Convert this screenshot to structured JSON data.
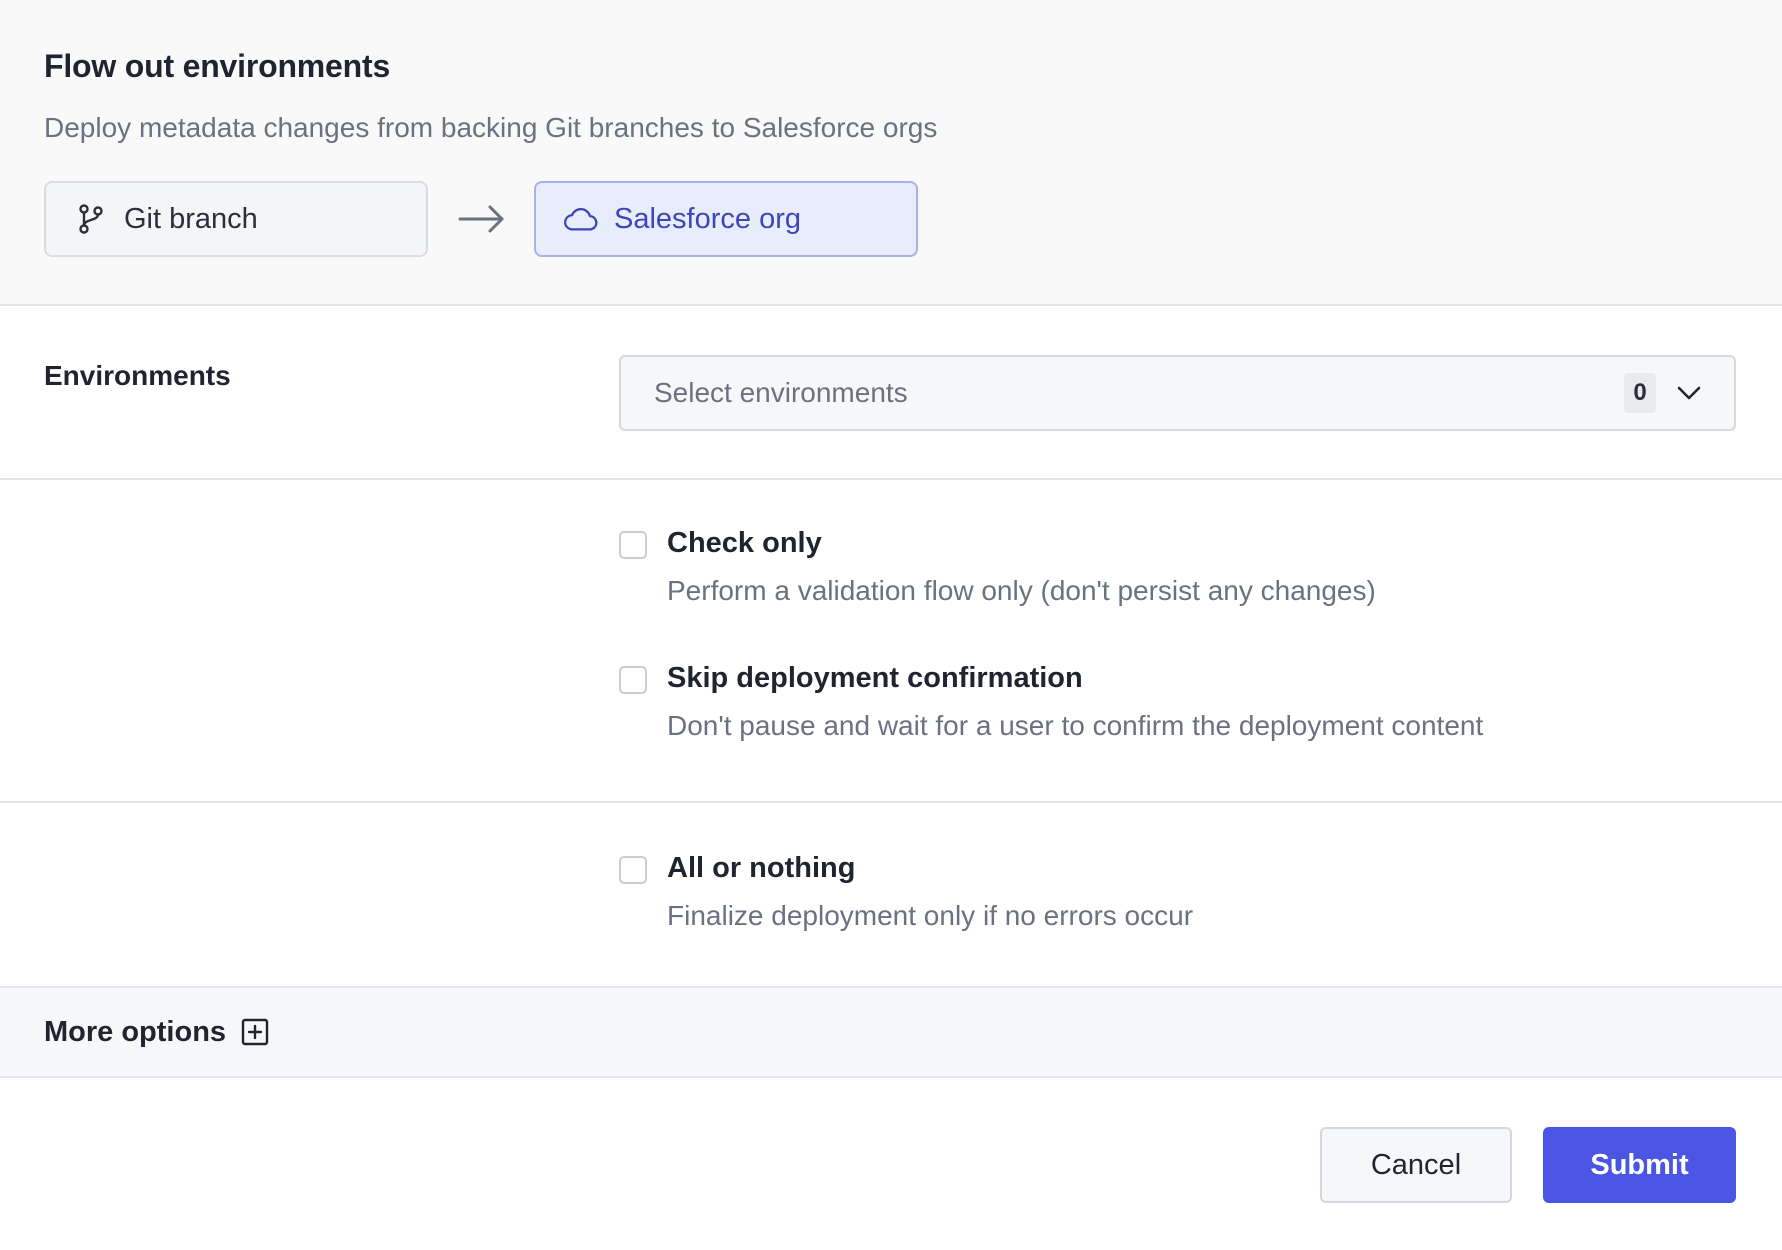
{
  "header": {
    "title": "Flow out environments",
    "subtitle": "Deploy metadata changes from backing Git branches to Salesforce orgs",
    "source": {
      "label": "Git branch",
      "icon": "git-branch-icon"
    },
    "arrow_icon": "arrow-right-icon",
    "target": {
      "label": "Salesforce org",
      "icon": "cloud-icon"
    }
  },
  "environments": {
    "label": "Environments",
    "placeholder": "Select environments",
    "count": "0",
    "chevron_icon": "chevron-down-icon"
  },
  "options": [
    {
      "label": "Check only",
      "description": "Perform a validation flow only (don't persist any changes)",
      "checked": false
    },
    {
      "label": "Skip deployment confirmation",
      "description": "Don't pause and wait for a user to confirm the deployment content",
      "checked": false
    },
    {
      "label": "All or nothing",
      "description": "Finalize deployment only if no errors occur",
      "checked": false
    }
  ],
  "more_options": {
    "label": "More options",
    "icon": "plus-square-icon"
  },
  "footer": {
    "cancel_label": "Cancel",
    "submit_label": "Submit"
  },
  "colors": {
    "accent": "#4a55e3",
    "target_bg": "#e9ecfb",
    "target_text": "#3b47b8",
    "muted_text": "#6b7180"
  }
}
